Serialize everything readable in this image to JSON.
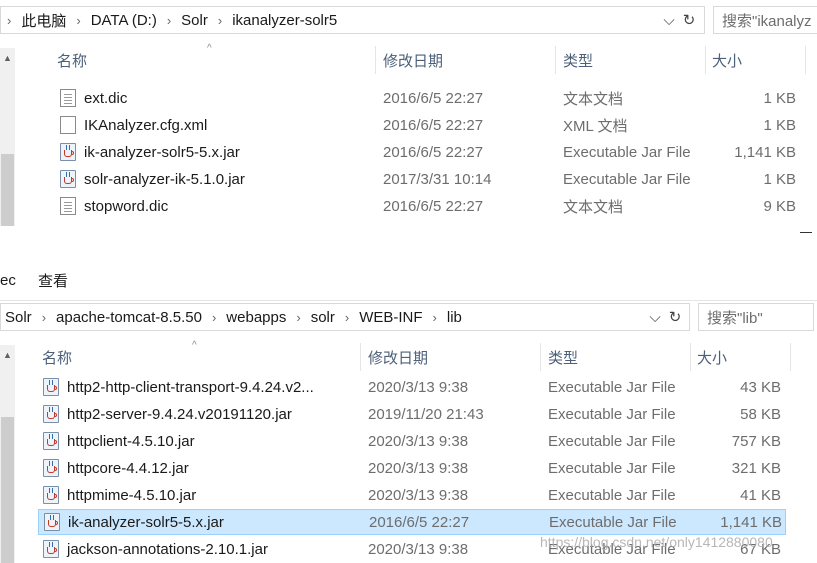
{
  "window1": {
    "breadcrumb": [
      "此电脑",
      "DATA (D:)",
      "Solr",
      "ikanalyzer-solr5"
    ],
    "search_placeholder": "搜索\"ikanalyz",
    "columns": {
      "name": "名称",
      "date": "修改日期",
      "type": "类型",
      "size": "大小"
    },
    "files": [
      {
        "name": "ext.dic",
        "date": "2016/6/5 22:27",
        "type": "文本文档",
        "size": "1 KB",
        "icon": "text-document-icon"
      },
      {
        "name": "IKAnalyzer.cfg.xml",
        "date": "2016/6/5 22:27",
        "type": "XML 文档",
        "size": "1 KB",
        "icon": "xml-file-icon"
      },
      {
        "name": "ik-analyzer-solr5-5.x.jar",
        "date": "2016/6/5 22:27",
        "type": "Executable Jar File",
        "size": "1,141 KB",
        "icon": "java-jar-icon"
      },
      {
        "name": "solr-analyzer-ik-5.1.0.jar",
        "date": "2017/3/31 10:14",
        "type": "Executable Jar File",
        "size": "1 KB",
        "icon": "java-jar-icon"
      },
      {
        "name": "stopword.dic",
        "date": "2016/6/5 22:27",
        "type": "文本文档",
        "size": "9 KB",
        "icon": "text-document-icon"
      }
    ]
  },
  "window2": {
    "menu_fragment": "ec",
    "menu_view": "查看",
    "breadcrumb": [
      "Solr",
      "apache-tomcat-8.5.50",
      "webapps",
      "solr",
      "WEB-INF",
      "lib"
    ],
    "search_placeholder": "搜索\"lib\"",
    "columns": {
      "name": "名称",
      "date": "修改日期",
      "type": "类型",
      "size": "大小"
    },
    "files": [
      {
        "name": "http2-http-client-transport-9.4.24.v2...",
        "date": "2020/3/13 9:38",
        "type": "Executable Jar File",
        "size": "43 KB"
      },
      {
        "name": "http2-server-9.4.24.v20191120.jar",
        "date": "2019/11/20 21:43",
        "type": "Executable Jar File",
        "size": "58 KB"
      },
      {
        "name": "httpclient-4.5.10.jar",
        "date": "2020/3/13 9:38",
        "type": "Executable Jar File",
        "size": "757 KB"
      },
      {
        "name": "httpcore-4.4.12.jar",
        "date": "2020/3/13 9:38",
        "type": "Executable Jar File",
        "size": "321 KB"
      },
      {
        "name": "httpmime-4.5.10.jar",
        "date": "2020/3/13 9:38",
        "type": "Executable Jar File",
        "size": "41 KB"
      },
      {
        "name": "ik-analyzer-solr5-5.x.jar",
        "date": "2016/6/5 22:27",
        "type": "Executable Jar File",
        "size": "1,141 KB",
        "selected": true
      },
      {
        "name": "jackson-annotations-2.10.1.jar",
        "date": "2020/3/13 9:38",
        "type": "Executable Jar File",
        "size": "67 KB"
      }
    ]
  },
  "watermark": "https://blog.csdn.net/only1412880080",
  "colors": {
    "selection": "#cce8ff",
    "selection_border": "#99d1ff",
    "header_text": "#4c607a",
    "secondary_text": "#6d6d6d"
  }
}
